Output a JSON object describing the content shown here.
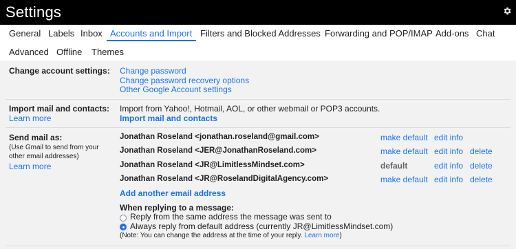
{
  "header": {
    "title": "Settings",
    "settings_icon": "gear-icon"
  },
  "tabs": [
    {
      "label": "General",
      "active": false
    },
    {
      "label": "Labels",
      "active": false
    },
    {
      "label": "Inbox",
      "active": false
    },
    {
      "label": "Accounts and Import",
      "active": true
    },
    {
      "label": "Filters and Blocked Addresses",
      "active": false
    },
    {
      "label": "Forwarding and POP/IMAP",
      "active": false
    },
    {
      "label": "Add-ons",
      "active": false
    },
    {
      "label": "Chat",
      "active": false
    },
    {
      "label": "Advanced",
      "active": false
    },
    {
      "label": "Offline",
      "active": false
    },
    {
      "label": "Themes",
      "active": false
    }
  ],
  "change_account": {
    "label": "Change account settings:",
    "links": [
      "Change password",
      "Change password recovery options",
      "Other Google Account settings"
    ]
  },
  "import_mail": {
    "label": "Import mail and contacts:",
    "learn_more": "Learn more",
    "description": "Import from Yahoo!, Hotmail, AOL, or other webmail or POP3 accounts.",
    "action": "Import mail and contacts"
  },
  "send_mail": {
    "label": "Send mail as:",
    "sub": "(Use Gmail to send from your other email addresses)",
    "learn_more": "Learn more",
    "addresses": [
      {
        "address": "Jonathan Roseland <jonathan.roseland@gmail.com>",
        "default_action": "make default",
        "edit": "edit info",
        "delete": ""
      },
      {
        "address": "Jonathan Roseland <JER@JonathanRoseland.com>",
        "default_action": "make default",
        "edit": "edit info",
        "delete": "delete"
      },
      {
        "address": "Jonathan Roseland <JR@LimitlessMindset.com>",
        "default_action": "default",
        "edit": "edit info",
        "delete": "delete"
      },
      {
        "address": "Jonathan Roseland <JR@RoselandDigitalAgency.com>",
        "default_action": "make default",
        "edit": "edit info",
        "delete": "delete"
      }
    ],
    "add_another": "Add another email address",
    "reply_heading": "When replying to a message:",
    "reply_options": [
      {
        "label": "Reply from the same address the message was sent to",
        "checked": false
      },
      {
        "label": "Always reply from default address (currently JR@LimitlessMindset.com)",
        "checked": true
      }
    ],
    "note_prefix": "(Note: You can change the address at the time of your reply.",
    "note_link": "Learn more",
    "note_suffix": ")"
  }
}
